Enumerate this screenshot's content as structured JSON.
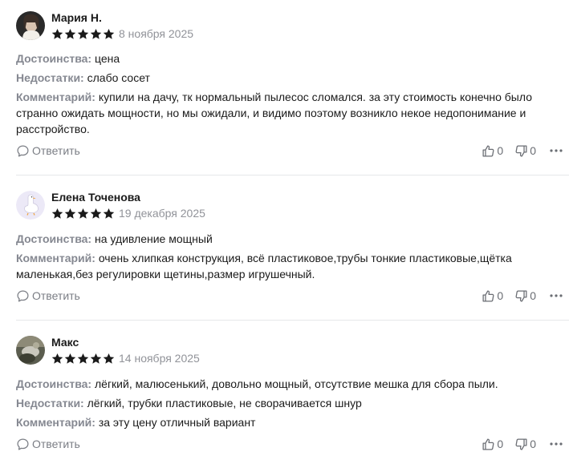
{
  "reviews": [
    {
      "author": "Мария Н.",
      "rating": 5,
      "date": "8 ноября 2025",
      "avatar": "photo-woman",
      "lines": [
        {
          "label": "Достоинства:",
          "text": "цена"
        },
        {
          "label": "Недостатки:",
          "text": "слабо сосет"
        },
        {
          "label": "Комментарий:",
          "text": "купили на дачу, тк нормальный пылесос сломался. за эту стоимость конечно было странно ожидать мощности, но мы ожидали, и видимо поэтому возникло некое недопонимание и расстройство."
        }
      ],
      "reply_label": "Ответить",
      "likes": "0",
      "dislikes": "0"
    },
    {
      "author": "Елена Точенова",
      "rating": 5,
      "date": "19 декабря 2025",
      "avatar": "goose-icon",
      "lines": [
        {
          "label": "Достоинства:",
          "text": "на удивление мощный"
        },
        {
          "label": "Комментарий:",
          "text": "очень хлипкая конструкция, всё пластиковое,трубы тонкие пластиковые,щётка маленькая,без регулировки щетины,размер игрушечный."
        }
      ],
      "reply_label": "Ответить",
      "likes": "0",
      "dislikes": "0"
    },
    {
      "author": "Макс",
      "rating": 5,
      "date": "14 ноября 2025",
      "avatar": "photo-outdoor",
      "lines": [
        {
          "label": "Достоинства:",
          "text": "лёгкий, малюсенький, довольно мощный, отсутствие мешка для сбора пыли."
        },
        {
          "label": "Недостатки:",
          "text": "лёгкий, трубки пластиковые, не сворачивается шнур"
        },
        {
          "label": "Комментарий:",
          "text": "за эту цену отличный вариант"
        }
      ],
      "reply_label": "Ответить",
      "likes": "0",
      "dislikes": "0"
    }
  ],
  "colors": {
    "star": "#1a1a1a",
    "label": "#858891",
    "date": "#919399",
    "divider": "#e6e7ea"
  }
}
